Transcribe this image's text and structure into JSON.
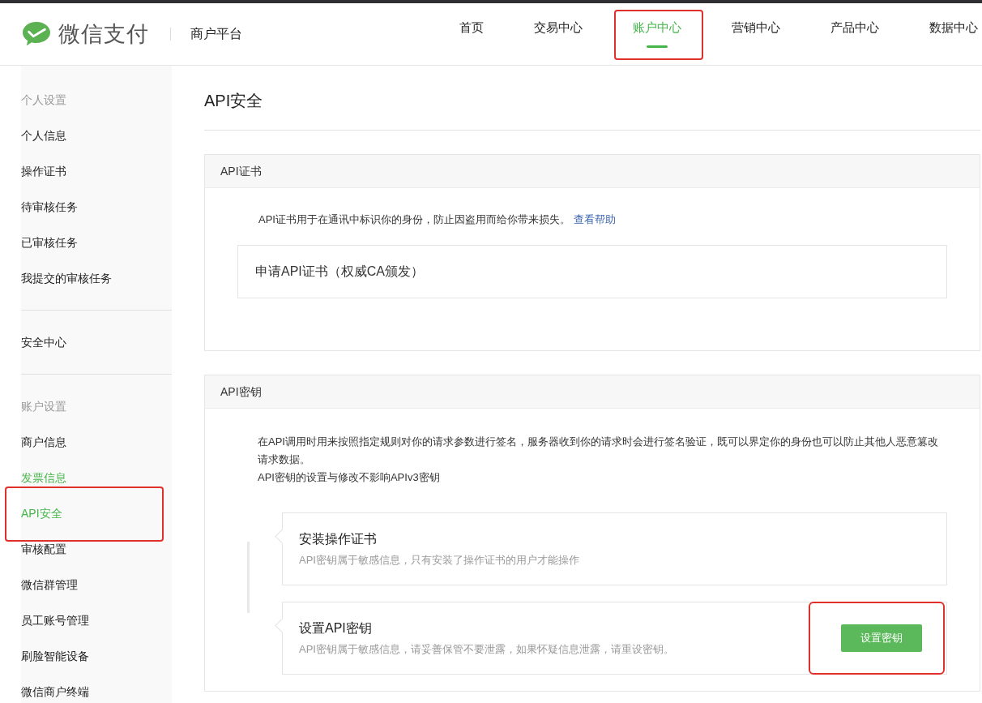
{
  "header": {
    "brand": "微信支付",
    "subtitle": "商户平台",
    "nav": [
      {
        "label": "首页",
        "selected": false,
        "highlighted": false
      },
      {
        "label": "交易中心",
        "selected": false,
        "highlighted": false
      },
      {
        "label": "账户中心",
        "selected": true,
        "highlighted": true
      },
      {
        "label": "营销中心",
        "selected": false,
        "highlighted": false
      },
      {
        "label": "产品中心",
        "selected": false,
        "highlighted": false
      },
      {
        "label": "数据中心",
        "selected": false,
        "highlighted": false
      }
    ]
  },
  "sidebar": {
    "groups": [
      {
        "title": "个人设置",
        "items": [
          {
            "label": "个人信息",
            "active": false,
            "highlighted": false
          },
          {
            "label": "操作证书",
            "active": false,
            "highlighted": false
          },
          {
            "label": "待审核任务",
            "active": false,
            "highlighted": false
          },
          {
            "label": "已审核任务",
            "active": false,
            "highlighted": false
          },
          {
            "label": "我提交的审核任务",
            "active": false,
            "highlighted": false
          }
        ]
      },
      {
        "items": [
          {
            "label": "安全中心",
            "active": false,
            "highlighted": false
          }
        ]
      },
      {
        "title": "账户设置",
        "items": [
          {
            "label": "商户信息",
            "active": false,
            "highlighted": false
          },
          {
            "label": "发票信息",
            "active": true,
            "highlighted": false
          },
          {
            "label": "API安全",
            "active": true,
            "highlighted": true
          },
          {
            "label": "审核配置",
            "active": false,
            "highlighted": false
          },
          {
            "label": "微信群管理",
            "active": false,
            "highlighted": false
          },
          {
            "label": "员工账号管理",
            "active": false,
            "highlighted": false
          },
          {
            "label": "刷脸智能设备",
            "active": false,
            "highlighted": false
          },
          {
            "label": "微信商户终端",
            "active": false,
            "highlighted": false
          }
        ]
      }
    ]
  },
  "page": {
    "title": "API安全",
    "cert_panel": {
      "title": "API证书",
      "description": "API证书用于在通讯中标识你的身份，防止因盗用而给你带来损失。",
      "help_link": "查看帮助",
      "apply_item": "申请API证书（权威CA颁发）"
    },
    "key_panel": {
      "title": "API密钥",
      "description": [
        "在API调用时用来按照指定规则对你的请求参数进行签名，服务器收到你的请求时会进行签名验证，既可以界定你的身份也可以防止其他人恶意篡改请求数据。",
        "API密钥的设置与修改不影响APIv3密钥"
      ],
      "steps": [
        {
          "title": "安装操作证书",
          "note": "API密钥属于敏感信息，只有安装了操作证书的用户才能操作"
        },
        {
          "title": "设置API密钥",
          "note": "API密钥属于敏感信息，请妥善保管不要泄露，如果怀疑信息泄露，请重设密钥。",
          "button": {
            "label": "设置密钥",
            "highlighted": true
          }
        }
      ]
    }
  }
}
